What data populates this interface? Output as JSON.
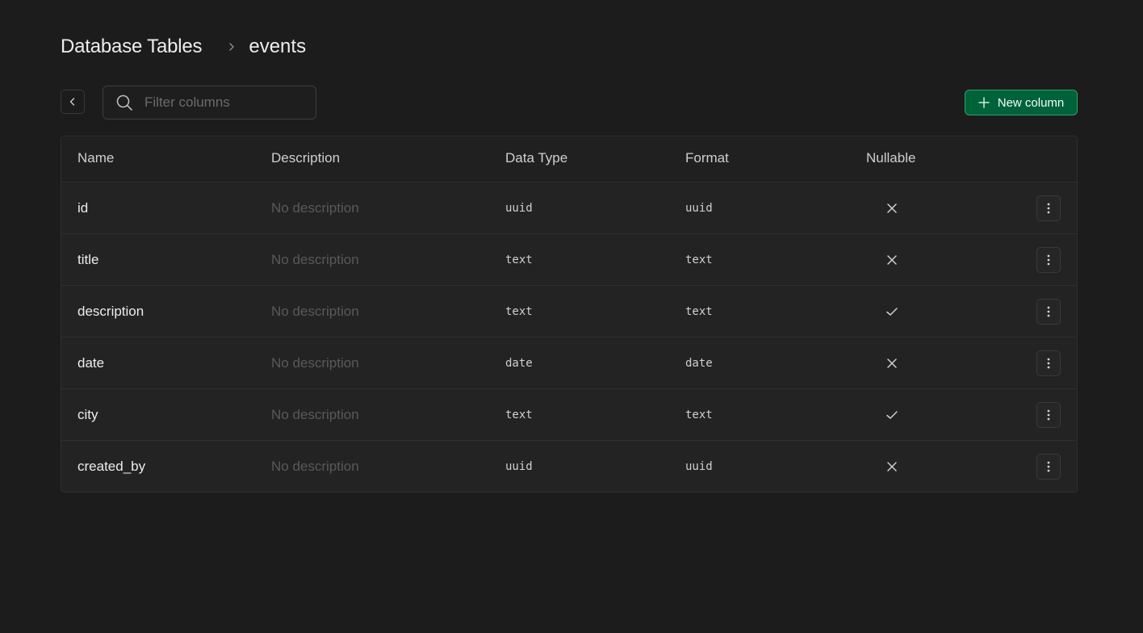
{
  "breadcrumb": {
    "root": "Database Tables",
    "current": "events"
  },
  "toolbar": {
    "search_placeholder": "Filter columns",
    "new_column_label": "New column"
  },
  "colors": {
    "background": "#1c1c1c",
    "accent": "#006239",
    "accent_border": "#2f9e6a"
  },
  "table": {
    "headers": {
      "name": "Name",
      "description": "Description",
      "data_type": "Data Type",
      "format": "Format",
      "nullable": "Nullable"
    },
    "rows": [
      {
        "name": "id",
        "description": "No description",
        "data_type": "uuid",
        "format": "uuid",
        "nullable": false
      },
      {
        "name": "title",
        "description": "No description",
        "data_type": "text",
        "format": "text",
        "nullable": false
      },
      {
        "name": "description",
        "description": "No description",
        "data_type": "text",
        "format": "text",
        "nullable": true
      },
      {
        "name": "date",
        "description": "No description",
        "data_type": "date",
        "format": "date",
        "nullable": false
      },
      {
        "name": "city",
        "description": "No description",
        "data_type": "text",
        "format": "text",
        "nullable": true
      },
      {
        "name": "created_by",
        "description": "No description",
        "data_type": "uuid",
        "format": "uuid",
        "nullable": false
      }
    ]
  }
}
